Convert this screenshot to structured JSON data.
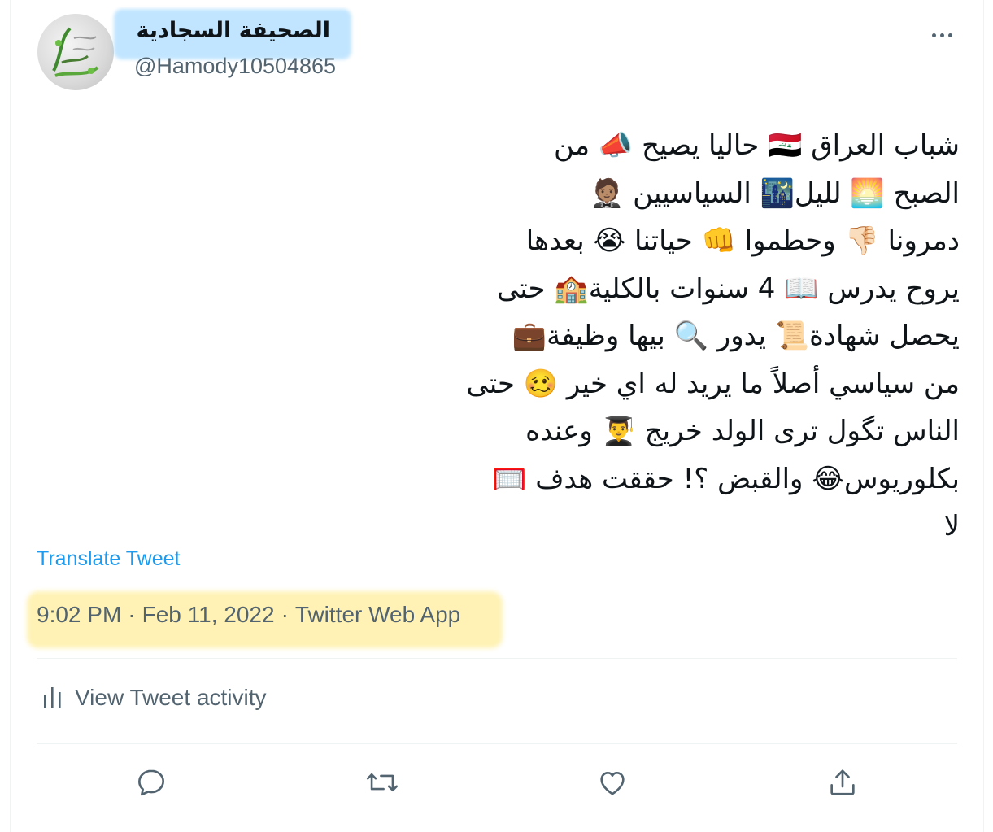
{
  "user": {
    "display_name": "الصحيفة السجادية",
    "handle": "@Hamody10504865",
    "avatar_icon": "calligraphy-avatar"
  },
  "tweet": {
    "lines": [
      "شباب العراق 🇮🇶 حاليا يصيح 📣 من",
      "الصبح 🌅 لليل🌃 السياسيين 🤵🏽",
      "دمرونا 👎🏻 وحطموا 👊 حياتنا 😭 بعدها",
      "يروح يدرس 📖 4 سنوات بالكلية🏫 حتى",
      "يحصل شهادة📜 يدور 🔍 بيها وظيفة💼",
      "من سياسي أصلاً ما يريد له اي خير 🥴 حتى",
      "الناس تگول ترى الولد خريج 👨‍🎓 وعنده",
      "بكلوريوس😂 والقبض ؟! حققت هدف 🥅",
      "لا"
    ],
    "translate_label": "Translate Tweet",
    "time": "9:02 PM",
    "date": "Feb 11, 2022",
    "source": "Twitter Web App",
    "separator": "·"
  },
  "activity": {
    "label": "View Tweet activity",
    "icon": "bar-chart-icon"
  },
  "actions": {
    "reply_icon": "reply-icon",
    "retweet_icon": "retweet-icon",
    "like_icon": "heart-icon",
    "share_icon": "share-icon"
  },
  "colors": {
    "link": "#1d9bf0",
    "secondary_text": "#536471",
    "primary_text": "#0f1419",
    "name_highlight": "#8fd0ff",
    "meta_highlight": "#fff0a8"
  }
}
